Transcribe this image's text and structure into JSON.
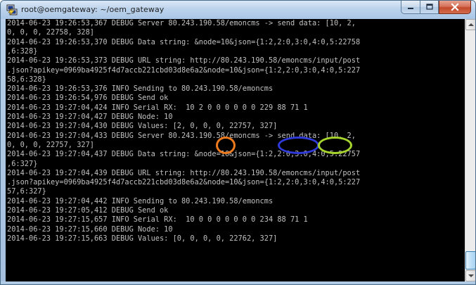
{
  "window": {
    "title": "root@oemgateway: ~/oem_gateway"
  },
  "icons": {
    "app": "putty-terminal-icon",
    "minimize": "minimize-icon",
    "maximize": "maximize-icon",
    "close": "close-icon",
    "scroll_up": "scroll-up-arrow-icon",
    "scroll_down": "scroll-down-arrow-icon"
  },
  "colors": {
    "terminal_background": "#000000",
    "terminal_text": "#c0c0c0",
    "annotation_orange": "#ee7a1e",
    "annotation_blue": "#2f3bd8",
    "annotation_green": "#a6d32c",
    "close_button": "#c24a2c"
  },
  "terminal": {
    "lines": [
      "2014-06-23 19:26:53,367 DEBUG Server 80.243.190.58/emoncms -> send data: [10, 2,",
      "0, 0, 0, 22758, 328]",
      "2014-06-23 19:26:53,370 DEBUG Data string: &node=10&json={1:2,2:0,3:0,4:0,5:22758",
      ",6:328}",
      "2014-06-23 19:26:53,373 DEBUG URL string: http://80.243.190.58/emoncms/input/post",
      ".json?apikey=0969ba4925f4d7accb221cbd03d8e6a2&node=10&json={1:2,2:0,3:0,4:0,5:227",
      "58,6:328}",
      "2014-06-23 19:26:53,376 INFO Sending to 80.243.190.58/emoncms",
      "2014-06-23 19:26:54,976 DEBUG Send ok",
      "2014-06-23 19:27:04,424 INFO Serial RX:  10 2 0 0 0 0 0 0 229 88 71 1",
      "2014-06-23 19:27:04,427 DEBUG Node: 10",
      "2014-06-23 19:27:04,430 DEBUG Values: [2, 0, 0, 0, 22757, 327]",
      "2014-06-23 19:27:04,433 DEBUG Server 80.243.190.58/emoncms -> send data: [10, 2,",
      "0, 0, 0, 22757, 327]",
      "2014-06-23 19:27:04,437 DEBUG Data string: &node=10&json={1:2,2:0,3:0,4:0,5:22757",
      ",6:327}",
      "2014-06-23 19:27:04,439 DEBUG URL string: http://80.243.190.58/emoncms/input/post",
      ".json?apikey=0969ba4925f4d7accb221cbd03d8e6a2&node=10&json={1:2,2:0,3:0,4:0,5:227",
      "57,6:327}",
      "2014-06-23 19:27:04,442 INFO Sending to 80.243.190.58/emoncms",
      "2014-06-23 19:27:05,412 DEBUG Send ok",
      "2014-06-23 19:27:15,657 INFO Serial RX:  10 0 0 0 0 0 0 0 234 88 71 1",
      "2014-06-23 19:27:15,660 DEBUG Node: 10",
      "2014-06-23 19:27:15,663 DEBUG Values: [0, 0, 0, 0, 22762, 327]"
    ]
  }
}
